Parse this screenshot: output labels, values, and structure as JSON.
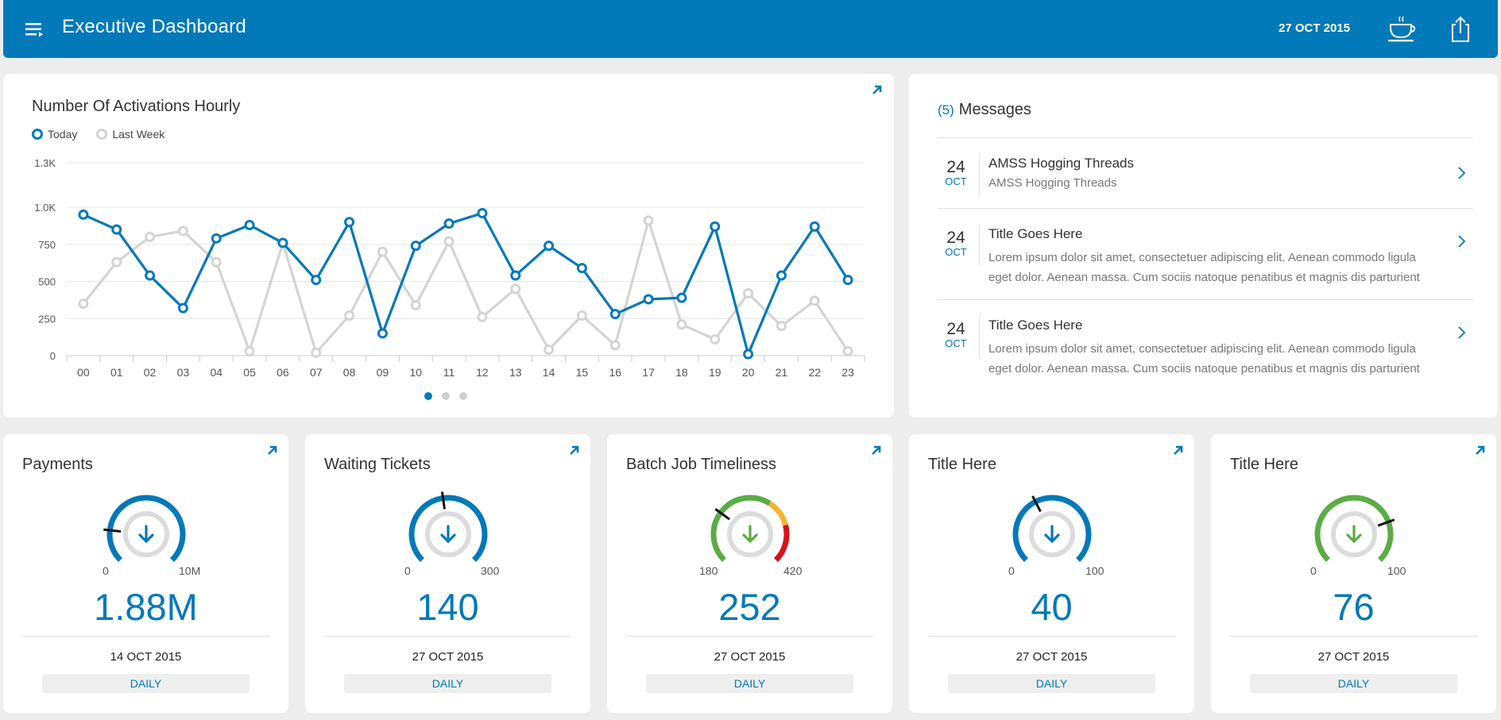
{
  "header": {
    "title": "Executive Dashboard",
    "date": "27 OCT 2015",
    "icons": [
      "menu-icon",
      "coffee-cup-icon",
      "share-icon"
    ],
    "background": "#0279b8"
  },
  "chart_data": {
    "type": "line",
    "title": "Number Of Activations Hourly",
    "categories": [
      "00",
      "01",
      "02",
      "03",
      "04",
      "05",
      "06",
      "07",
      "08",
      "09",
      "10",
      "11",
      "12",
      "13",
      "14",
      "15",
      "16",
      "17",
      "18",
      "19",
      "20",
      "21",
      "22",
      "23"
    ],
    "series": [
      {
        "name": "Today",
        "color": "#0279b8",
        "values": [
          950,
          850,
          540,
          320,
          790,
          880,
          760,
          510,
          900,
          150,
          740,
          890,
          960,
          540,
          740,
          590,
          280,
          380,
          390,
          870,
          10,
          540,
          870,
          510
        ]
      },
      {
        "name": "Last Week",
        "color": "#d4d4d4",
        "values": [
          350,
          630,
          800,
          840,
          630,
          30,
          760,
          20,
          270,
          700,
          340,
          770,
          260,
          450,
          40,
          270,
          70,
          910,
          210,
          110,
          420,
          200,
          370,
          30
        ]
      }
    ],
    "y_ticks": [
      "0",
      "250",
      "500",
      "750",
      "1.0K",
      "1.3K"
    ],
    "ylim": [
      0,
      1300
    ],
    "grid": true,
    "legend_position": "top-left"
  },
  "chart_pager": {
    "pages": 3,
    "active": 0
  },
  "messages": {
    "count": "(5)",
    "title": "Messages",
    "items": [
      {
        "day": "24",
        "month": "OCT",
        "title": "AMSS Hogging Threads",
        "subtitle": "AMSS Hogging Threads"
      },
      {
        "day": "24",
        "month": "OCT",
        "title": "Title Goes Here",
        "body": "Lorem ipsum dolor sit amet, consectetuer adipiscing elit. Aenean commodo ligula eget dolor. Aenean massa. Cum sociis natoque penatibus et magnis dis parturient"
      },
      {
        "day": "24",
        "month": "OCT",
        "title": "Title Goes Here",
        "body": "Lorem ipsum dolor sit amet, consectetuer adipiscing elit. Aenean commodo ligula eget dolor. Aenean massa. Cum sociis natoque penatibus et magnis dis parturient"
      }
    ]
  },
  "kpis": [
    {
      "title": "Payments",
      "min": "0",
      "max": "10M",
      "value": "1.88M",
      "date": "14 OCT 2015",
      "period": "DAILY",
      "level": 0.19,
      "colors": [
        "#0279b8"
      ]
    },
    {
      "title": "Waiting Tickets",
      "min": "0",
      "max": "300",
      "value": "140",
      "date": "27 OCT 2015",
      "period": "DAILY",
      "level": 0.47,
      "colors": [
        "#0279b8"
      ]
    },
    {
      "title": "Batch Job Timeliness",
      "min": "180",
      "max": "420",
      "value": "252",
      "date": "27 OCT 2015",
      "period": "DAILY",
      "level": 0.3,
      "colors": [
        "#5aac44",
        "#f5b331",
        "#d9121b"
      ]
    },
    {
      "title": "Title Here",
      "min": "0",
      "max": "100",
      "value": "40",
      "date": "27 OCT 2015",
      "period": "DAILY",
      "level": 0.4,
      "colors": [
        "#0279b8"
      ]
    },
    {
      "title": "Title Here",
      "min": "0",
      "max": "100",
      "value": "76",
      "date": "27 OCT 2015",
      "period": "DAILY",
      "level": 0.76,
      "colors": [
        "#5aac44"
      ]
    }
  ]
}
